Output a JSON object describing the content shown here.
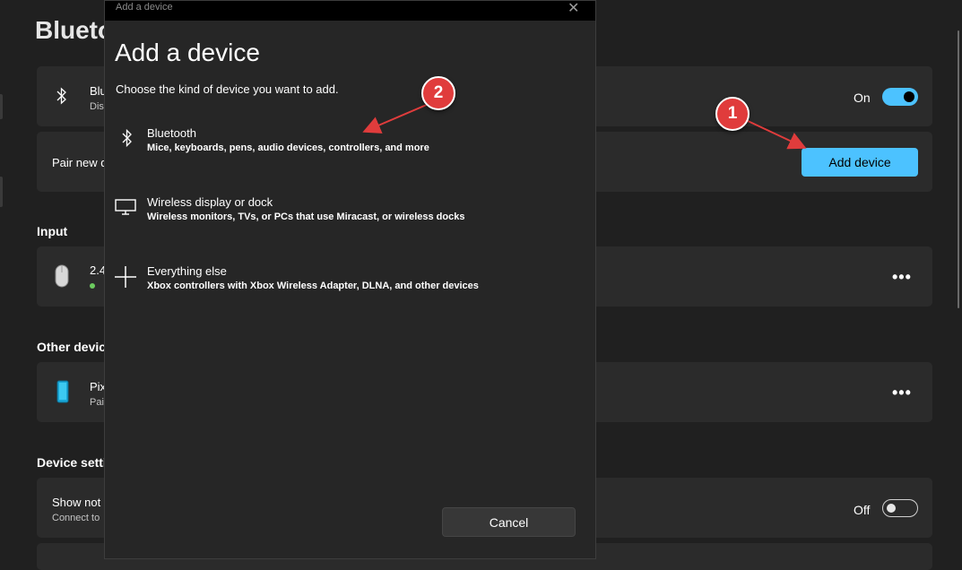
{
  "page": {
    "title": "Blueto",
    "bluetooth_row": {
      "label": "Blu",
      "sub": "Dis",
      "toggle_label": "On"
    },
    "pair_row": {
      "label": "Pair new d",
      "button_label": "Add device"
    },
    "input_section": {
      "title": "Input",
      "device_name": "2.4"
    },
    "other_section": {
      "title": "Other device",
      "device_name": "Pix",
      "device_sub": "Pai"
    },
    "settings_section": {
      "title": "Device settin",
      "row_label": "Show not",
      "row_sub": "Connect to",
      "toggle_label": "Off"
    },
    "more_label": "•••"
  },
  "dialog": {
    "window_title": "Add a device",
    "heading": "Add a device",
    "subtitle": "Choose the kind of device you want to add.",
    "options": [
      {
        "icon": "bluetooth-icon",
        "title": "Bluetooth",
        "description": "Mice, keyboards, pens, audio devices, controllers, and more"
      },
      {
        "icon": "monitor-icon",
        "title": "Wireless display or dock",
        "description": "Wireless monitors, TVs, or PCs that use Miracast, or wireless docks"
      },
      {
        "icon": "plus-icon",
        "title": "Everything else",
        "description": "Xbox controllers with Xbox Wireless Adapter, DLNA, and other devices"
      }
    ],
    "cancel_label": "Cancel"
  },
  "annotations": {
    "badge1": "1",
    "badge2": "2",
    "color": "#e03c3c"
  },
  "colors": {
    "accent": "#4cc2ff",
    "background": "#202020",
    "card": "#2b2b2b",
    "dialog": "#262626"
  }
}
